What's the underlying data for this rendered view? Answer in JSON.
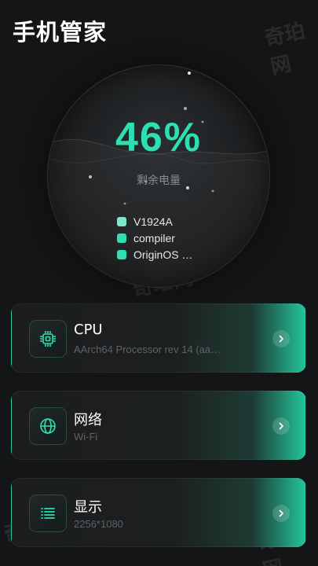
{
  "header": {
    "title": "手机管家"
  },
  "watermark": {
    "text": "奇珀网"
  },
  "battery": {
    "percent_text": "46%",
    "percent_value": 46,
    "label": "剩余电量",
    "accent_color": "#2de0b4",
    "info": [
      {
        "text": "V1924A"
      },
      {
        "text": "compiler"
      },
      {
        "text": "OriginOS …"
      }
    ]
  },
  "cards": [
    {
      "title": "CPU",
      "subtitle": "AArch64 Processor rev 14 (aa…",
      "icon": "chip-icon"
    },
    {
      "title": "网络",
      "subtitle": "Wi-Fi",
      "icon": "globe-icon"
    },
    {
      "title": "显示",
      "subtitle": "2256*1080",
      "icon": "list-icon"
    }
  ]
}
